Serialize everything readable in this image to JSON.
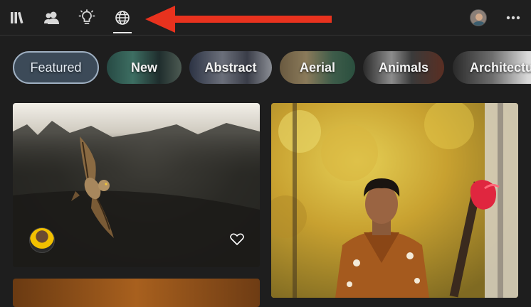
{
  "topbar": {
    "nav_icons": [
      "library-icon",
      "people-icon",
      "lightbulb-icon",
      "globe-icon"
    ],
    "active_icon": "globe-icon",
    "annotation_arrow_color": "#e8321e",
    "more_icon": "more-icon",
    "avatar": "user-avatar"
  },
  "chips": [
    {
      "label": "Featured",
      "selected": true
    },
    {
      "label": "New",
      "selected": false
    },
    {
      "label": "Abstract",
      "selected": false
    },
    {
      "label": "Aerial",
      "selected": false
    },
    {
      "label": "Animals",
      "selected": false
    },
    {
      "label": "Architecture",
      "selected": false
    }
  ],
  "cards": [
    {
      "subject": "owl-in-flight",
      "liked": false
    },
    {
      "subject": "portrait-with-guitar",
      "liked": false
    }
  ],
  "colors": {
    "background": "#1e1e1e",
    "chip_selected": "#3c4a58",
    "chip_selected_border": "#9fb0c2",
    "arrow": "#e8321e"
  }
}
